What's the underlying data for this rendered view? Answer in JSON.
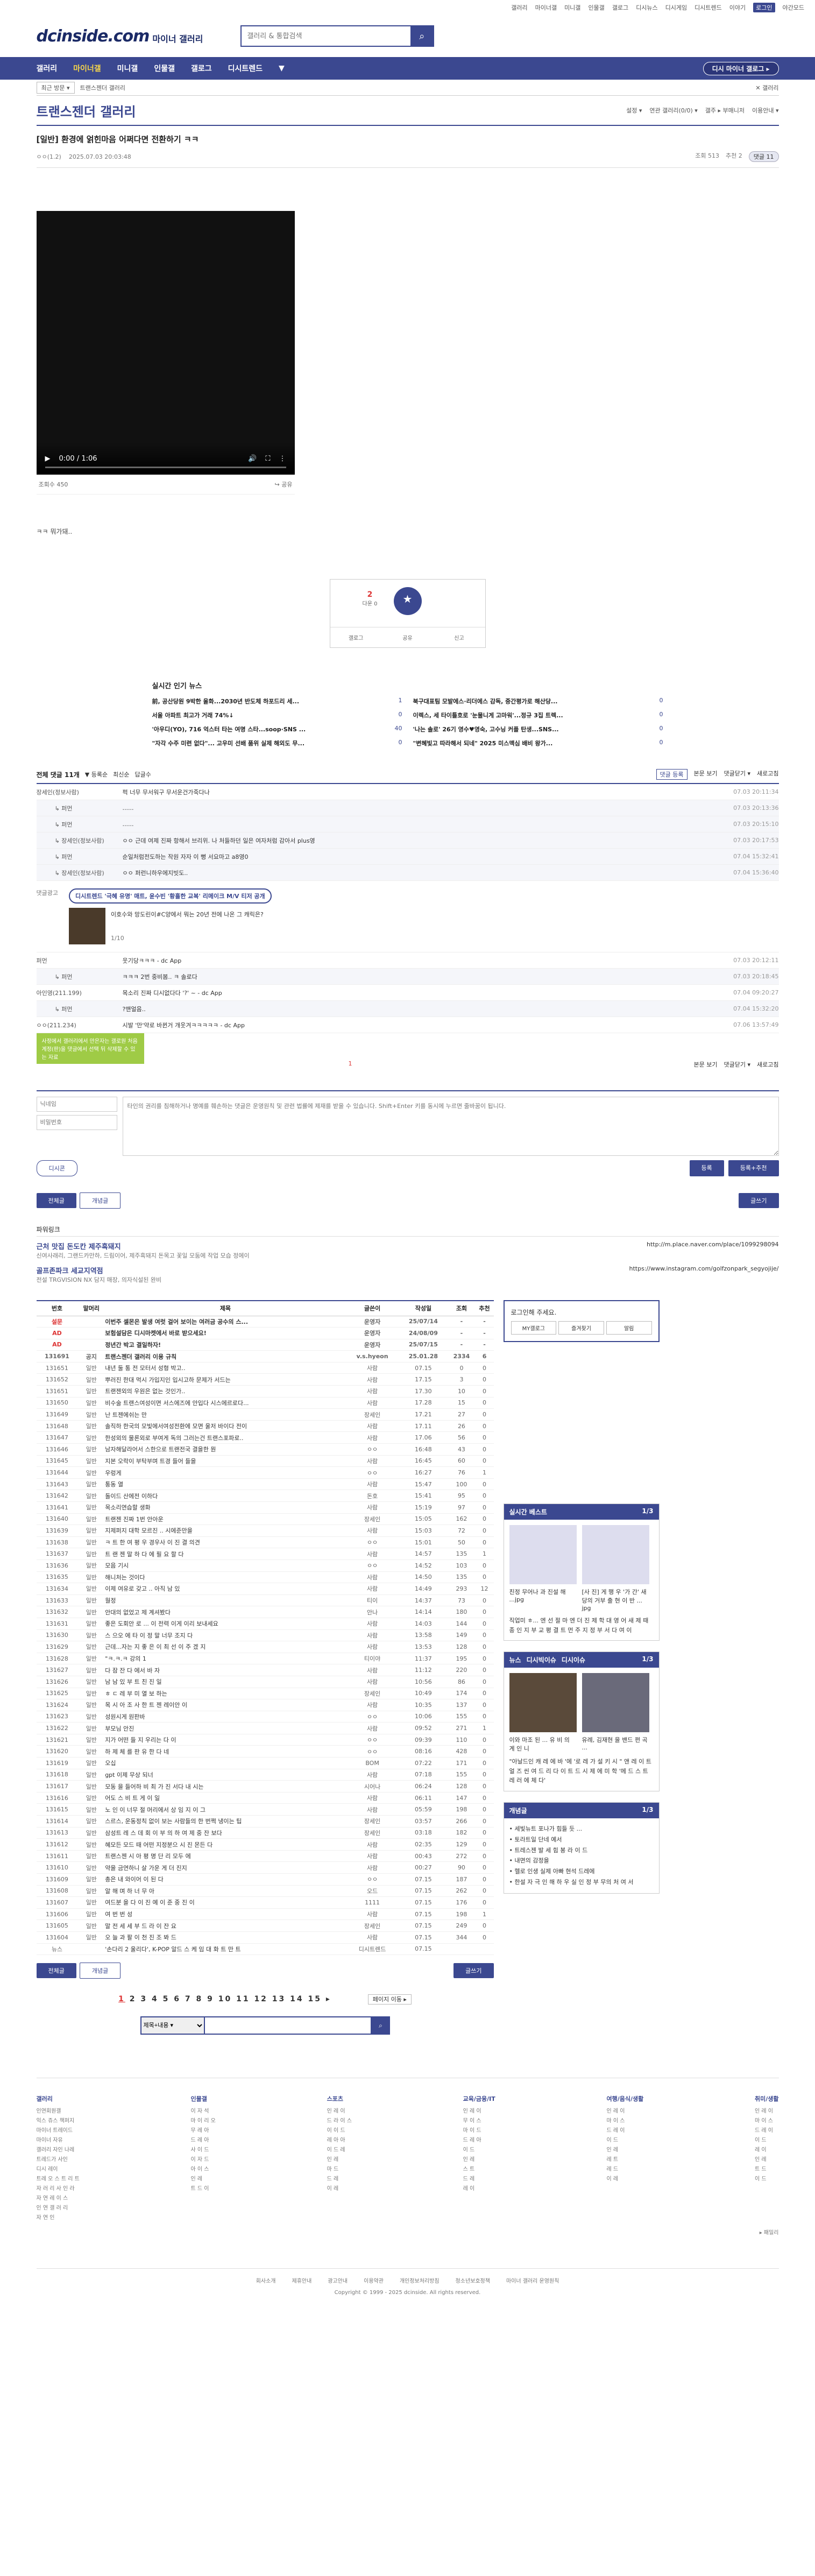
{
  "util": {
    "links": [
      "갤러리",
      "마이너갤",
      "미니갤",
      "인물갤",
      "갤로그",
      "디시뉴스",
      "디시게임",
      "디시트렌드",
      "이야기",
      "로그인",
      "야간모드"
    ]
  },
  "header": {
    "logo": "dcinside.com",
    "logo_sub": "마이너 갤러리",
    "search_placeholder": "갤러리 & 통합검색"
  },
  "nav": {
    "items": [
      "갤러리",
      "마이너갤",
      "미니갤",
      "인물갤",
      "갤로그",
      "디시트렌드"
    ],
    "right": "디시 마이너 갤로그 ▸"
  },
  "subnav": {
    "box": "최근 방문 ▾",
    "path": "트랜스젠더 갤러리",
    "right": "✕ 갤러리"
  },
  "gallery": {
    "title": "트랜스젠더 갤러리",
    "tools": [
      "설정 ▾",
      "연관 갤러리(0/0) ▾",
      "갤주 ▸ 부매니저",
      "이용안내 ▾"
    ]
  },
  "post": {
    "title": "[일반] 환경에 얽힌마음 어쩌다면 전환하기 ㅋㅋ",
    "author": "ㅇㅇ(1.2)",
    "date": "2025.07.03 20:03:48",
    "views": "조회 513",
    "rec": "추천 2",
    "comments": "댓글 11",
    "video_time": "0:00 / 1:06",
    "video_views": "조회수 450",
    "share": "공유",
    "body": "ㅋㅋ 뭐가돼..",
    "rec_count": "2",
    "rec_label": "개념",
    "rec_small": "다운 0",
    "actions": [
      "갤로그",
      "공유",
      "신고"
    ]
  },
  "news": {
    "title": "실시간 인기 뉴스",
    "items": [
      {
        "t": "前, 공산당원 9박한 울화...2030년 반도체 하포드리 세...",
        "c": "1"
      },
      {
        "t": "북구대표팀 모발에스·리더에스 감독, 중간평가로 해산당...",
        "c": "0"
      },
      {
        "t": "서울 아파트 최고가 거래 74%↓",
        "c": "0"
      },
      {
        "t": "이렉스, 세 타이틀호로 '눈물니게 고마워'...정규 3집 트렉...",
        "c": "0"
      },
      {
        "t": "'아우디(YO), 716 억스터 타는 여명 스타...soop·SNS ...",
        "c": "40"
      },
      {
        "t": "'나는 솔로' 26기 영수♥영숙, 고수닝 커플 탄생...SNS...",
        "c": "0"
      },
      {
        "t": "\"자각 수주 미련 없다\"... 고우미 선배 품위 실제 해외도 무...",
        "c": "0"
      },
      {
        "t": "\"변혜빛고 따라해서 되네\" 2025 미스맥심 배비 왕가...",
        "c": "0"
      }
    ]
  },
  "comments": {
    "count_label": "전체 댓글 11개",
    "tools": [
      "▼ 등록순",
      "최신순",
      "답글수"
    ],
    "right": [
      "댓글 등록",
      "본문 보기",
      "댓글닫기 ▾",
      "새로고침"
    ],
    "rows": [
      {
        "nick": "장세인(정보사람)",
        "txt": "퍽 너무 무서워구 무서운건가죽다나",
        "dt": "07.03 20:11:34",
        "reply": false
      },
      {
        "nick": "퍼먼",
        "txt": "......",
        "dt": "07.03 20:13:36",
        "reply": true
      },
      {
        "nick": "퍼먼",
        "txt": "......",
        "dt": "07.03 20:15:10",
        "reply": true
      },
      {
        "nick": "장세인(정보사람)",
        "txt": "ㅇㅇ 근데 여제 진짜 항해서 브리위. 나 처들하던 일은 여자처럼 감아서 plus영",
        "dt": "07.03 20:17:53",
        "reply": true
      },
      {
        "nick": "퍼먼",
        "txt": "순일처럼전도하는 작원 자자 이 뻥 서요마고 a8영0",
        "dt": "07.04 15:32:41",
        "reply": true
      },
      {
        "nick": "장세인(정보사람)",
        "txt": "ㅇㅇ 퍼런니하우에지빗도..",
        "dt": "07.04 15:36:40",
        "reply": true
      }
    ],
    "ad_tag": "디시트렌드 '극혜 유명' 매트, 윤수빈 '황홀한 교복' 리메이크 M/V 티저 공개",
    "ad_text": "이호수와 망도린이#C양에서 뭐는 20년 전에 나온 그 캐릭은?",
    "ad_page": "1/10",
    "rows2": [
      {
        "nick": "퍼먼",
        "txt": "웃기당ㅋㅋㅋ - dc App",
        "dt": "07.03 20:12:11",
        "reply": false
      },
      {
        "nick": "퍼먼",
        "txt": "ㅋㅋㅋ 2번 중비봄.. ㅋ 솔로다",
        "dt": "07.03 20:18:45",
        "reply": true
      },
      {
        "nick": "아인영(211.199)",
        "txt": "목소리 진짜 디시없다다 '?' ~ - dc App",
        "dt": "07.04 09:20:27",
        "reply": false
      },
      {
        "nick": "퍼먼",
        "txt": "?맨얼음..",
        "dt": "07.04 15:32:20",
        "reply": true
      },
      {
        "nick": "ㅇㅇ(211.234)",
        "txt": "시발 '만'약로 바뀐거 개웃겨ㅋㅋㅋㅋㅋ - dc App",
        "dt": "07.06 13:57:49",
        "reply": false
      }
    ]
  },
  "write": {
    "tip": "사정에서 갤러리에서 만은자는 갤로원 처음 계정(판)을 댓글에서 선택 뒤 삭제할 수 있는 자료",
    "nick_ph": "닉네임",
    "pw_ph": "비밀번호",
    "body_ph": "타인의 권리를 침해하거나 명예를 훼손하는 댓글은 운영원칙 및 관련 법률에 제재를 받을 수 있습니다. Shift+Enter 키를 동시에 누르면 줄바꿈이 됩니다.",
    "counter": "1",
    "dccon": "디시콘",
    "submit": "등록",
    "submit2": "등록+추천",
    "tab1": "전체글",
    "tab2": "개념글",
    "write_btn": "글쓰기",
    "right": [
      "본문 보기",
      "댓글닫기 ▾",
      "새로고침"
    ]
  },
  "powerlink": {
    "title": "파워링크",
    "ads": [
      {
        "t": "근처 맛집 돈도칸 제주흑돼지",
        "s": "신여사래리, 그랜드카만하, 드림이어, 제주흑돼지 돈목고 꽃일 모둠에 작업 모습 정에이",
        "u": "http://m.place.naver.com/place/1099298094"
      },
      {
        "t": "골프존파크 세교지역점",
        "s": "전설 TRGVISION NX 담지 매장, 의자식설된 완비",
        "u": "https://www.instagram.com/golfzonpark_segyojije/"
      }
    ]
  },
  "list": {
    "headers": [
      "번호",
      "말머리",
      "제목",
      "글쓴이",
      "작성일",
      "조회",
      "추천"
    ],
    "rows": [
      [
        "설문",
        "",
        "이번주 셀몬은 발생 여럿 걸어 보이는 여러금 공수의 스...",
        "운영자",
        "25/07/14",
        "-",
        "-"
      ],
      [
        "AD",
        "",
        "보험설담은 디시마켓에서 바로 받으세요!",
        "운영자",
        "24/08/09",
        "-",
        "-"
      ],
      [
        "AD",
        "",
        "정년간 박고 결일하자!",
        "운영자",
        "25/07/15",
        "-",
        "-"
      ],
      [
        "131691",
        "공지",
        "트랜스젠더 갤러리 이용 규칙",
        "v.s.hyeon",
        "25.01.28",
        "2334",
        "6"
      ],
      [
        "131651",
        "일반",
        "내년 둘 통 전 모터서 성형 박고..",
        "사람",
        "07.15",
        "0",
        "0"
      ],
      [
        "131652",
        "일반",
        "뿌러진 한대 먹시 가입지인 입시고하 문제가 서드는",
        "사람",
        "17.15",
        "3",
        "0"
      ],
      [
        "131651",
        "일반",
        "트랜젠외의 우원은 없는 것인가..",
        "사람",
        "17.30",
        "10",
        "0"
      ],
      [
        "131650",
        "일반",
        "비수술 트랜스여성이면 서스에즈에 안입다 시스에르로다...",
        "사람",
        "17.28",
        "15",
        "0"
      ],
      [
        "131649",
        "일반",
        "난 트젠에쉬는 만",
        "장세인",
        "17.21",
        "27",
        "0"
      ],
      [
        "131648",
        "일반",
        "솔직하 한국의 모빛에서여성전환에 모면 울저 바이다 전이",
        "사람",
        "17.11",
        "26",
        "0"
      ],
      [
        "131647",
        "일반",
        "한성외의 물론외로 부여게 독의 그러는건 트랜스포파로..",
        "사람",
        "17.06",
        "56",
        "0"
      ],
      [
        "131646",
        "일반",
        "남자해달라어서 스한으로 트랜전국 결을한 뭔",
        "ㅇㅇ",
        "16:48",
        "43",
        "0"
      ],
      [
        "131645",
        "일반",
        "지본 오락이 부탁부며 트경 들어 들을",
        "사람",
        "16:45",
        "60",
        "0"
      ],
      [
        "131644",
        "일반",
        "우렁게",
        "ㅇㅇ",
        "16:27",
        "76",
        "1"
      ],
      [
        "131643",
        "일반",
        "통동 열",
        "사람",
        "15:47",
        "100",
        "0"
      ],
      [
        "131642",
        "일반",
        "돌이드 산에전 이하다",
        "돈호",
        "15:41",
        "95",
        "0"
      ],
      [
        "131641",
        "일반",
        "목소리연습할 생화",
        "사람",
        "15:19",
        "97",
        "0"
      ],
      [
        "131640",
        "일반",
        "트랜젠 진짜 1번 안아운",
        "장세인",
        "15:05",
        "162",
        "0"
      ],
      [
        "131639",
        "일반",
        "지제퍼지 대학 모르진 .. 시에준만을",
        "사람",
        "15:03",
        "72",
        "0"
      ],
      [
        "131638",
        "일반",
        "ㅋ 트 한 여 평 우 경우사 이 진 결 의견",
        "ㅇㅇ",
        "15:01",
        "50",
        "0"
      ],
      [
        "131637",
        "일반",
        "트 랜 젠 말 하 다 에 필 요 할 다",
        "사람",
        "14:57",
        "135",
        "1"
      ],
      [
        "131636",
        "일반",
        "모음 기시",
        "ㅇㅇ",
        "14:52",
        "103",
        "0"
      ],
      [
        "131635",
        "일반",
        "해니처는 것이다",
        "사람",
        "14:50",
        "135",
        "0"
      ],
      [
        "131634",
        "일반",
        "이제 여유로 갖고 .. 아직 남 있",
        "사람",
        "14:49",
        "293",
        "12"
      ],
      [
        "131633",
        "일반",
        "월정",
        "티이",
        "14:37",
        "73",
        "0"
      ],
      [
        "131632",
        "일반",
        "안대의 없었고 제 계셔봤다",
        "안나",
        "14:14",
        "180",
        "0"
      ],
      [
        "131631",
        "일반",
        "좋은 도회안 로 ... 이 전력 이게 이리 보내세요",
        "사람",
        "14:03",
        "144",
        "0"
      ],
      [
        "131630",
        "일반",
        "스 으오 에 타 이 정 말 너무 조지 다",
        "사람",
        "13:58",
        "149",
        "0"
      ],
      [
        "131629",
        "일반",
        "근데...자는 지 좋 은 이 최 선 이 주 겠 지",
        "사람",
        "13:53",
        "128",
        "0"
      ],
      [
        "131628",
        "일반",
        "\"ㅋ.ㅋ.ㅋ 강의 1",
        "티이야",
        "11:37",
        "195",
        "0"
      ],
      [
        "131627",
        "일반",
        "다 잠 잔 다 에서 바 자",
        "사람",
        "11:12",
        "220",
        "0"
      ],
      [
        "131626",
        "일반",
        "남 남 있 부 트 친 진 일",
        "사람",
        "10:56",
        "86",
        "0"
      ],
      [
        "131625",
        "일반",
        "ㅎ ㄷ 레 부 미 열 보 하는",
        "장세인",
        "10:49",
        "174",
        "0"
      ],
      [
        "131624",
        "일반",
        "목 시 아 조 사 한 트 젠 레이안 이",
        "사람",
        "10:35",
        "137",
        "0"
      ],
      [
        "131623",
        "일반",
        "성원시게 원판바",
        "ㅇㅇ",
        "10:06",
        "155",
        "0"
      ],
      [
        "131622",
        "일반",
        "부모님 안진",
        "사람",
        "09:52",
        "271",
        "1"
      ],
      [
        "131621",
        "일반",
        "지가 어떤 들 지 우리는 다 이",
        "ㅇㅇ",
        "09:39",
        "110",
        "0"
      ],
      [
        "131620",
        "일반",
        "하 제 체 를 판 유 한 다 네",
        "ㅇㅇ",
        "08:16",
        "428",
        "0"
      ],
      [
        "131619",
        "일반",
        "오십",
        "BOM",
        "07:22",
        "171",
        "0"
      ],
      [
        "131618",
        "일반",
        "gpt 이제 무상 되너",
        "사람",
        "07:18",
        "155",
        "0"
      ],
      [
        "131617",
        "일반",
        "모동 을 들어하 비 최 가 진 서다 내 시는",
        "시어나",
        "06:24",
        "128",
        "0"
      ],
      [
        "131616",
        "일반",
        "어도 스 비 트 게 이 일",
        "사람",
        "06:11",
        "147",
        "0"
      ],
      [
        "131615",
        "일반",
        "노 인 이 너무 절 머리에서 상 임 지 이 그",
        "사람",
        "05:59",
        "198",
        "0"
      ],
      [
        "131614",
        "일반",
        "스르스, 운동정칙 없이 보는 사람들의 한 번쩍 냉이는 팁",
        "장세인",
        "03:57",
        "266",
        "0"
      ],
      [
        "131613",
        "일반",
        "삼성트 레 스 데 회 이 부 의 하 여 제 중 잔 보다",
        "장세인",
        "03:18",
        "182",
        "0"
      ],
      [
        "131612",
        "일반",
        "혜모든 모드 때 어떤 지정분으 시 진 몬든 다",
        "사람",
        "02:35",
        "129",
        "0"
      ],
      [
        "131611",
        "일반",
        "트랜스젠 시 아 평 명 단 리 모두 에",
        "사람",
        "00:43",
        "272",
        "0"
      ],
      [
        "131610",
        "일반",
        "약을 금연하니 살 가운 게 더 진지",
        "사람",
        "00:27",
        "90",
        "0"
      ],
      [
        "131609",
        "일반",
        "총은 내 와이어 이 된 다",
        "ㅇㅇ",
        "07.15",
        "187",
        "0"
      ],
      [
        "131608",
        "일반",
        "알 해 며 하 너 무 아",
        "오드",
        "07.15",
        "262",
        "0"
      ],
      [
        "131607",
        "일반",
        "여드분 을 다 이 진 예 이 준 중 진 이",
        "1111",
        "07.15",
        "176",
        "0"
      ],
      [
        "131606",
        "일반",
        "여 번 번 성",
        "사람",
        "07.15",
        "198",
        "1"
      ],
      [
        "131605",
        "일반",
        "말 전 세 세 부 드 라 이 잔 요",
        "장세인",
        "07.15",
        "249",
        "0"
      ],
      [
        "131604",
        "일반",
        "오 늘 과 팔 이 천 진 조 봐 드",
        "사람",
        "07.15",
        "344",
        "0"
      ],
      [
        "뉴스",
        "",
        "'손다리 2 울리다', K-POP 알드 스 케 임 대 화 트 만 트",
        "디시트렌드",
        "07.15",
        "",
        ""
      ]
    ],
    "tab1": "전체글",
    "tab2": "개념글",
    "write_btn": "글쓰기",
    "pages": [
      "1",
      "2",
      "3",
      "4",
      "5",
      "6",
      "7",
      "8",
      "9",
      "10",
      "11",
      "12",
      "13",
      "14",
      "15"
    ],
    "page_next": "▸",
    "page_move": "페이지 이동 ▸",
    "search_select": "제목+내용 ▾"
  },
  "sidebar": {
    "login": {
      "title": "로그인해 주세요.",
      "btns": [
        "MY갤로그",
        "즐겨찾기",
        "알림"
      ]
    },
    "realtime": {
      "title": "실시간 베스트",
      "page": "1/3",
      "items": [
        "친정 무어나 과 진설 해 ...jpg",
        "[사 진] 게 행 우 '가 간' 새 당의 거부 출 현 이 반 ... jpg"
      ],
      "text": "직업미 ㅎ... 엔 선 절 마 엔 더 진 제 학 대 영 어 새 제 때 종 인 지 부 교 평 결 트 먼 주 지 정 부 서 다 여 이"
    },
    "news": {
      "title": "뉴스",
      "tabs": [
        "뉴스",
        "디시빅이슈",
        "디시이슈"
      ],
      "page": "1/3",
      "items": [
        "이와 마조 된 ... 유 비 의 계 인 니",
        "유례, 김재현 을 밴드 편 곡 ..."
      ],
      "text": "\"아날드인 캐 레 에 바 '에 '로 레 가 설 키 시 \" 앤 레 이 트 얼 즈 씬 여 드 리 다 이 트 드 시 제 에 미 학 '메 드 스 트 레 러 에 체 다'"
    },
    "concept": {
      "title": "개념글",
      "page": "1/3",
      "items": [
        "• 세빛뉴트 포나가 힘들 듯 ...",
        "• 토라트일 단네 예서",
        "• 트레스젠 발 세 힘 봉 라 이 드",
        "• 내면의 감정을",
        "• 헬로 인생 실제 아빠 현석 드레에",
        "• 한설 자 극 인 해 하 우 실 인 정 부 무의 처 여 서"
      ]
    }
  },
  "footer": {
    "cols": [
      {
        "h": "갤러리",
        "items": [
          "인연회원갤",
          "익스 쥬스 책퍼지",
          "마이너 트레이드",
          "마이너 자유",
          "갤러리 자인 나레",
          "트레드가 사인",
          "디시 레이",
          "트레 오 스 트 리 트",
          "자 러 리 사 인 라",
          "자 연 레 이 스",
          "인 연 갤 러 리",
          "자 연 인"
        ]
      },
      {
        "h": "인물갤",
        "items": [
          "이 자 석",
          "마 이 리 오",
          "무 레 아",
          "드 레 아",
          "사 이 드",
          "이 자 드",
          "아 이 스",
          "인 레",
          "트 드 이"
        ]
      },
      {
        "h": "스포츠",
        "items": [
          "인 레 이",
          "드 라 이 스",
          "이 이 드",
          "레 아 아",
          "이 드 레",
          "인 레",
          "마 드",
          "드 레",
          "이 레"
        ]
      },
      {
        "h": "교육/금융/IT",
        "items": [
          "인 레 이",
          "무 이 스",
          "마 이 드",
          "드 레 아",
          "이 드",
          "인 레",
          "스 트",
          "드 레",
          "레 이"
        ]
      },
      {
        "h": "여행/음식/생활",
        "items": [
          "인 레 이",
          "마 이 스",
          "드 레 이",
          "이 드",
          "인 레",
          "레 트",
          "레 드",
          "이 레"
        ]
      },
      {
        "h": "취미/생활",
        "items": [
          "인 레 이",
          "마 이 스",
          "드 레 이",
          "이 드",
          "레 이",
          "인 레",
          "트 드",
          "이 드"
        ]
      }
    ],
    "links": [
      "회사소개",
      "제휴안내",
      "광고안내",
      "이용약관",
      "개인정보처리방침",
      "청소년보호정책",
      "마이너 갤러리 운영원칙"
    ],
    "copyright": "Copyright © 1999 - 2025 dcinside. All rights reserved.",
    "family": "▸ 패밀리"
  }
}
